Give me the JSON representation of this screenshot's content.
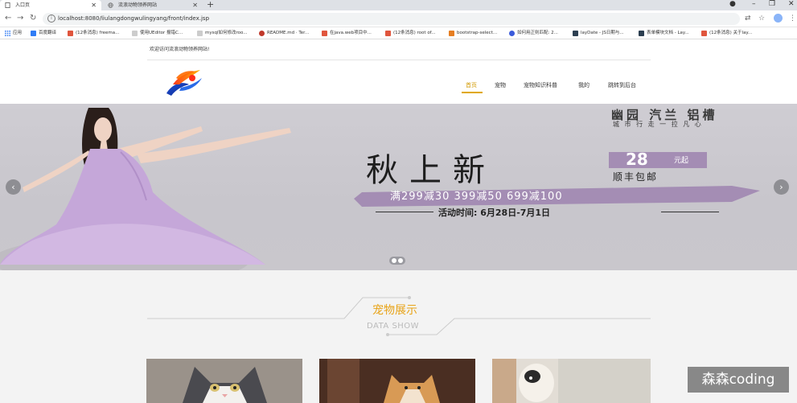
{
  "browser": {
    "tabs": [
      {
        "title": "入口页",
        "active": true
      },
      {
        "title": "流浪动物领养网站",
        "active": false
      }
    ],
    "url": "localhost:8080/liulangdongwulingyang/front/index.jsp",
    "bookmarks": [
      {
        "label": "应用",
        "color": "#4285f4"
      },
      {
        "label": "百度翻译",
        "color": "#2f7cf6"
      },
      {
        "label": "(12条消息) freema...",
        "color": "#e0553d"
      },
      {
        "label": "使用UEditor 报错C...",
        "color": "#555555"
      },
      {
        "label": "mysql如何修改roo...",
        "color": "#555555"
      },
      {
        "label": "README.md · Ter...",
        "color": "#c0392b"
      },
      {
        "label": "在java.web项目中...",
        "color": "#e0553d"
      },
      {
        "label": "(12条消息) root of...",
        "color": "#e0553d"
      },
      {
        "label": "bootstrap-select...",
        "color": "#e67e22"
      },
      {
        "label": "如何用正则匹配: 2...",
        "color": "#3b5bdb"
      },
      {
        "label": "layDate - JS日期与...",
        "color": "#2c3e50"
      },
      {
        "label": "表单模块文档 - Lay...",
        "color": "#2c3e50"
      },
      {
        "label": "(12条消息) 关于lay...",
        "color": "#e0553d"
      }
    ]
  },
  "site": {
    "welcome": "欢迎访问流浪动物领养网站!",
    "nav": [
      {
        "label": "首页",
        "active": true
      },
      {
        "label": "宠物",
        "active": false
      },
      {
        "label": "宠物知识科普",
        "active": false
      },
      {
        "label": "我的",
        "active": false
      },
      {
        "label": "跳转到后台",
        "active": false
      }
    ],
    "banner": {
      "brand": "幽园 汽兰 铝槽",
      "brand_sub": "城 市 行 走 一 拉 凡 心",
      "headline": "秋上新",
      "price": "28",
      "price_unit": "元起",
      "shipping": "顺丰包邮",
      "promo": "满299减30 399减50 699减100",
      "dates": "活动时间: 6月28日-7月1日"
    },
    "section": {
      "title": "宠物展示",
      "subtitle": "DATA SHOW"
    }
  },
  "watermark": "森森coding"
}
